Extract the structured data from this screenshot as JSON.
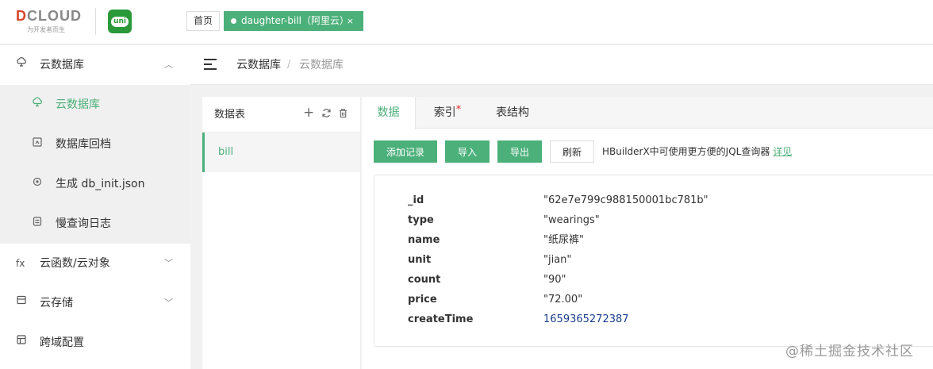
{
  "header": {
    "logo_text_d": "D",
    "logo_text_rest": "CLOUD",
    "logo_slogan": "为开发者而生",
    "uni_label": "uni",
    "home_tab": "首页",
    "active_tab": "daughter-bill（阿里云）",
    "close_glyph": "×"
  },
  "sidebar": {
    "groups": [
      {
        "label": "云数据库",
        "icon": "cloud-database-icon",
        "chevron": "︿"
      },
      {
        "label": "云函数/云对象",
        "icon": "fx-icon",
        "chevron": "﹀"
      },
      {
        "label": "云存储",
        "icon": "storage-icon",
        "chevron": "﹀"
      },
      {
        "label": "跨域配置",
        "icon": "cors-icon"
      }
    ],
    "sub_items": [
      {
        "label": "云数据库",
        "icon": "db-icon"
      },
      {
        "label": "数据库回档",
        "icon": "rollback-icon"
      },
      {
        "label": "生成 db_init.json",
        "icon": "generate-icon"
      },
      {
        "label": "慢查询日志",
        "icon": "log-icon"
      }
    ]
  },
  "breadcrumb": {
    "root": "云数据库",
    "separator": "/",
    "current": "云数据库"
  },
  "tables": {
    "title": "数据表",
    "add": "+",
    "refresh": "⟳",
    "delete": "🗑",
    "items": [
      "bill"
    ]
  },
  "tabs": {
    "data": "数据",
    "index": "索引",
    "index_star": "*",
    "schema": "表结构"
  },
  "toolbar": {
    "add_record": "添加记录",
    "import": "导入",
    "export": "导出",
    "refresh": "刷新",
    "hint": "HBuilderX中可使用更方便的JQL查询器",
    "hint_link": "详见"
  },
  "record": [
    {
      "key": "_id",
      "value": "\"62e7e799c988150001bc781b\""
    },
    {
      "key": "type",
      "value": "\"wearings\""
    },
    {
      "key": "name",
      "value": "\"纸尿裤\""
    },
    {
      "key": "unit",
      "value": "\"jian\""
    },
    {
      "key": "count",
      "value": "\"90\""
    },
    {
      "key": "price",
      "value": "\"72.00\""
    },
    {
      "key": "createTime",
      "value": "1659365272387"
    }
  ],
  "watermark": "@稀土掘金技术社区"
}
